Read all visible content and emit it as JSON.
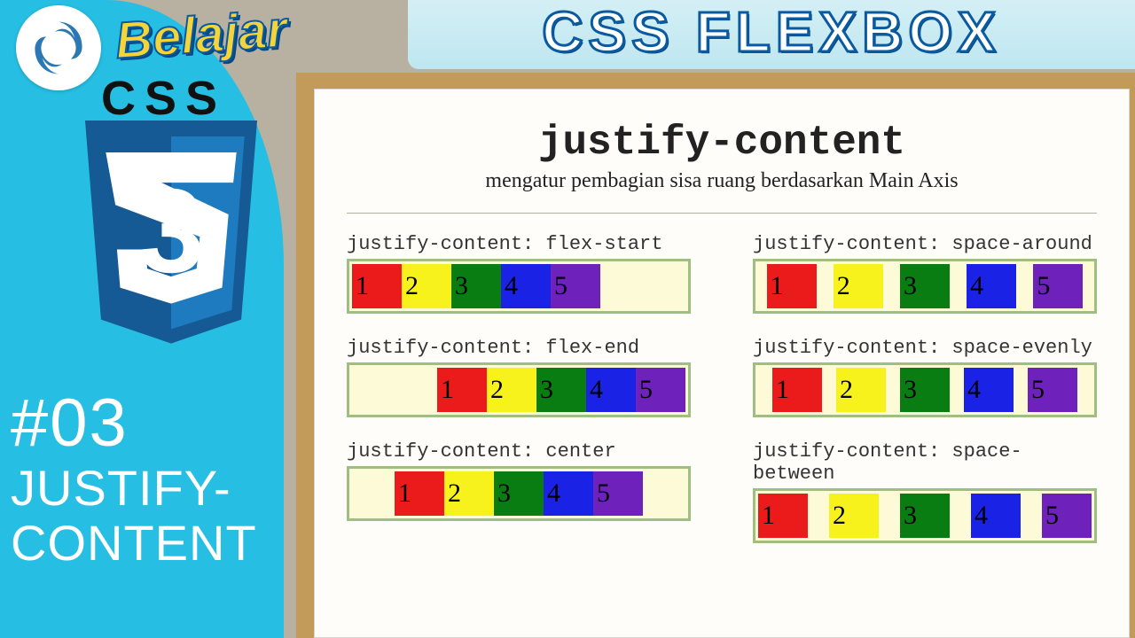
{
  "header": {
    "title_left": "Belajar",
    "title_right": "CSS FLEXBOX",
    "css_label": "CSS",
    "shield_number": "3",
    "episode_number": "#03",
    "episode_title": "JUSTIFY-CONTENT"
  },
  "whiteboard": {
    "title": "justify-content",
    "subtitle": "mengatur pembagian sisa ruang berdasarkan Main Axis"
  },
  "examples": [
    {
      "label": "justify-content: flex-start",
      "mode": "flex-start"
    },
    {
      "label": "justify-content: space-around",
      "mode": "space-around"
    },
    {
      "label": "justify-content: flex-end",
      "mode": "flex-end"
    },
    {
      "label": "justify-content: space-evenly",
      "mode": "space-evenly"
    },
    {
      "label": "justify-content: center",
      "mode": "center"
    },
    {
      "label": "justify-content: space-between",
      "mode": "space-between"
    }
  ],
  "items": [
    "1",
    "2",
    "3",
    "4",
    "5"
  ],
  "colors": {
    "accent_cyan": "#26bfe3",
    "shield_blue": "#1e7bc0",
    "item1": "#eb1b1b",
    "item2": "#f7f21b",
    "item3": "#0a7d12",
    "item4": "#1a22e6",
    "item5": "#6f21bc",
    "container_bg": "#fdfbd7",
    "container_border": "#9fbf82"
  }
}
